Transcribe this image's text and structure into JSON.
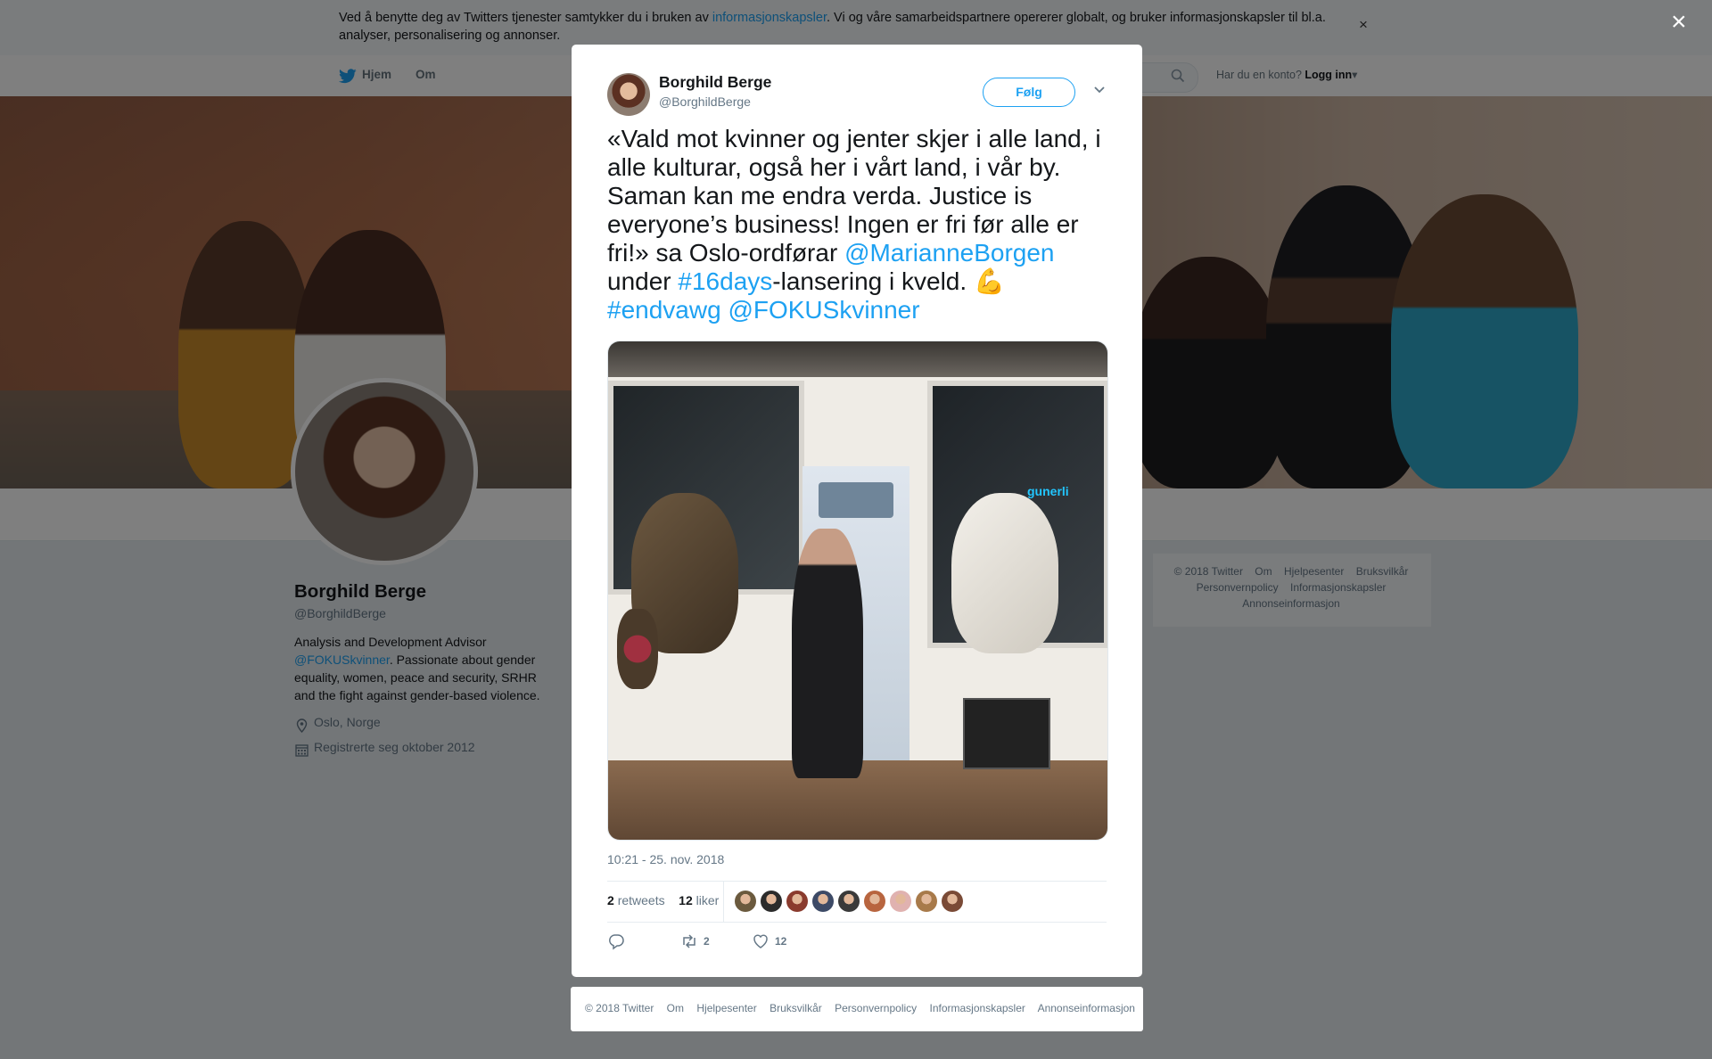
{
  "cookie_bar": {
    "text_before": "Ved å benytte deg av Twitters tjenester samtykker du i bruken av ",
    "link": "informasjonskapsler",
    "text_after": ". Vi og våre samarbeidspartnere opererer globalt, og bruker informasjonskapsler til bl.a. analyser, personalisering og annonser.",
    "close": "×"
  },
  "nav": {
    "home": "Hjem",
    "about": "Om",
    "account_prompt": "Har du en konto?",
    "login": "Logg inn"
  },
  "profile": {
    "name": "Borghild Berge",
    "handle": "@BorghildBerge",
    "bio_before": "Analysis and Development Advisor ",
    "bio_link": "@FOKUSkvinner",
    "bio_after": ". Passionate about gender equality, women, peace and security, SRHR and the fight against gender-based violence.",
    "location": "Oslo, Norge",
    "joined": "Registrerte seg oktober 2012"
  },
  "side_footer": {
    "links": [
      "© 2018 Twitter",
      "Om",
      "Hjelpesenter",
      "Bruksvilkår",
      "Personvernpolicy",
      "Informasjonskapsler",
      "Annonseinformasjon"
    ]
  },
  "overlay": {
    "close": "×"
  },
  "tweet": {
    "author_name": "Borghild Berge",
    "author_handle": "@BorghildBerge",
    "follow_label": "Følg",
    "text_part1": "«Vald mot kvinner og jenter skjer i alle land, i alle kulturar, også her i vårt land, i vår by. Saman kan me endra verda. Justice is everyone’s business! Ingen er fri før alle er fri!» sa Oslo-ordførar ",
    "mention1": "@MarianneBorgen",
    "text_part2": " under ",
    "hashtag1": "#16days",
    "text_part3": "-lansering i kveld. ",
    "emoji": "💪",
    "hashtag2": "#endvawg",
    "mention2": "@FOKUSkvinner",
    "photo_sign": "gunerli",
    "timestamp": "10:21 - 25. nov. 2018",
    "retweets_count": "2",
    "retweets_label": "retweets",
    "likes_count": "12",
    "likes_label": "liker",
    "action_retweet_count": "2",
    "action_like_count": "12",
    "liker_colors": [
      "#6b5a3e",
      "#2b2b2b",
      "#8a3b2e",
      "#3d4a66",
      "#3a3a3a",
      "#b8653f",
      "#e0b2b0",
      "#a87a4a",
      "#7a4a36"
    ]
  },
  "bottom_footer": {
    "links": [
      "© 2018 Twitter",
      "Om",
      "Hjelpesenter",
      "Bruksvilkår",
      "Personvernpolicy",
      "Informasjonskapsler",
      "Annonseinformasjon"
    ]
  },
  "colors": {
    "twitter_blue": "#1da1f2",
    "overlay": "rgba(0,0,0,0.5)"
  }
}
